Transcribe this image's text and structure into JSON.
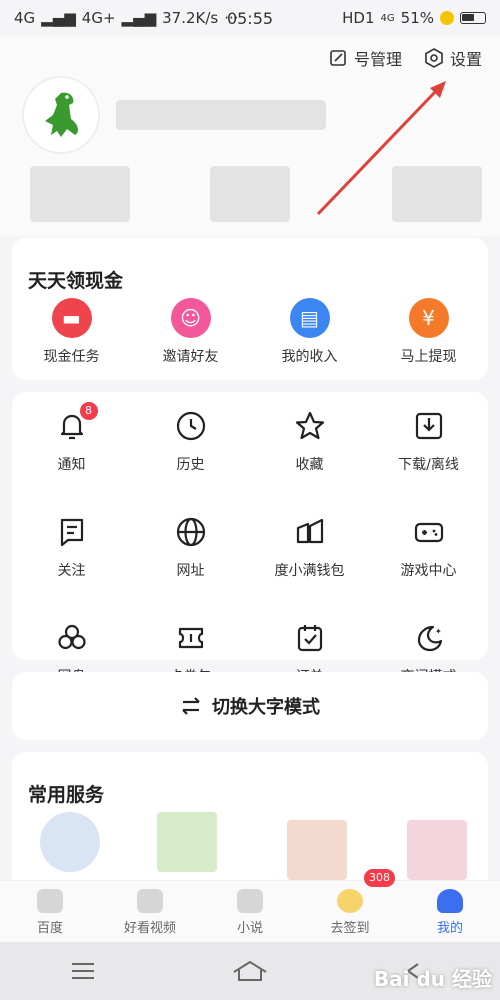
{
  "status_bar": {
    "signal1": "4G",
    "signal2": "4G+",
    "speed": "37.2K/s",
    "dots": "···",
    "time": "05:55",
    "hd": "HD1",
    "net": "4G",
    "battery": "51%"
  },
  "header": {
    "account_mgmt": "号管理",
    "settings": "设置"
  },
  "cash_card": {
    "title": "天天领现金",
    "items": [
      {
        "label": "现金任务",
        "color": "#f0444d"
      },
      {
        "label": "邀请好友",
        "color": "#f2589a"
      },
      {
        "label": "我的收入",
        "color": "#3b86f0"
      },
      {
        "label": "马上提现",
        "color": "#f47a2a"
      }
    ]
  },
  "tools": {
    "items": [
      {
        "label": "通知",
        "icon": "bell-icon",
        "badge": "8"
      },
      {
        "label": "历史",
        "icon": "clock-icon"
      },
      {
        "label": "收藏",
        "icon": "star-icon"
      },
      {
        "label": "下载/离线",
        "icon": "download-icon"
      },
      {
        "label": "关注",
        "icon": "bookmark-icon"
      },
      {
        "label": "网址",
        "icon": "globe-icon"
      },
      {
        "label": "度小满钱包",
        "icon": "wallet-icon"
      },
      {
        "label": "游戏中心",
        "icon": "gamepad-icon"
      },
      {
        "label": "网盘",
        "icon": "cloud-drive-icon"
      },
      {
        "label": "卡券包",
        "icon": "ticket-icon"
      },
      {
        "label": "订单",
        "icon": "order-icon"
      },
      {
        "label": "夜间模式",
        "icon": "moon-icon"
      }
    ]
  },
  "big_font": {
    "label": "切换大字模式"
  },
  "services": {
    "title": "常用服务"
  },
  "bottom_nav": {
    "items": [
      {
        "label": "百度"
      },
      {
        "label": "好看视频"
      },
      {
        "label": "小说"
      },
      {
        "label": "去签到",
        "badge": "308"
      },
      {
        "label": "我的",
        "active": true
      }
    ]
  },
  "watermark": "Bai du 经验"
}
